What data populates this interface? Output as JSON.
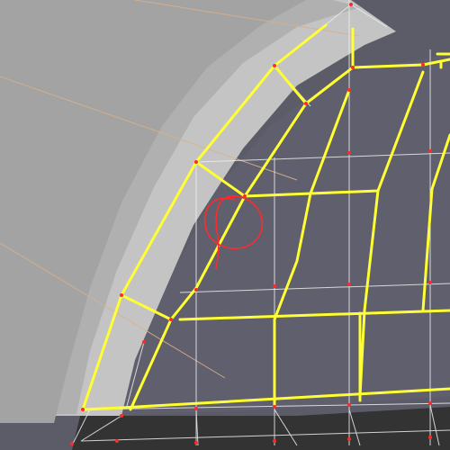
{
  "viewport": {
    "view_type": "3d-modeling-viewport-mesh-edit",
    "colors": {
      "background": "#5c5c69",
      "surface_far": "#a2a2a2",
      "surface_mid": "#b4b4b4",
      "surface_near": "#c6c6c6",
      "ground": "#333333",
      "wire": "#ffffff",
      "selected_edge": "#ffff33",
      "vertex": "#ff2a2a",
      "annotation": "#ff2a2a",
      "guide_line": "#d9b089"
    },
    "icons": [
      "vertex-dot-icon",
      "red-circle-annotation-icon"
    ]
  }
}
